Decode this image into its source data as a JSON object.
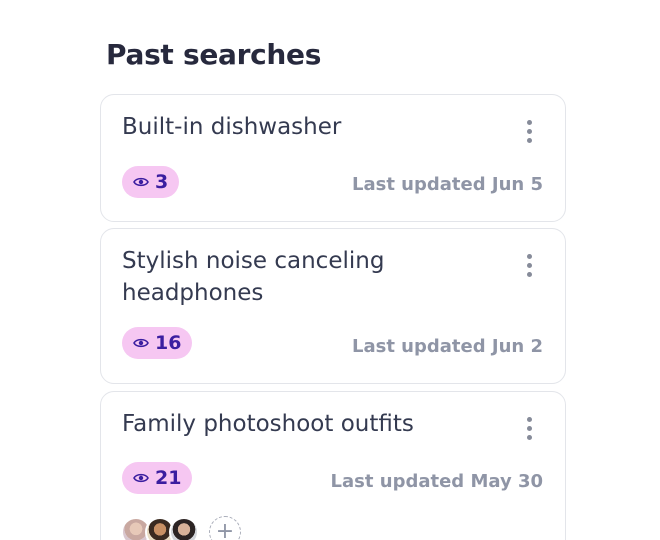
{
  "page": {
    "title": "Past searches"
  },
  "colors": {
    "badge_bg": "#f6c7f2",
    "badge_text": "#3b1ea0",
    "title_text": "#27293d",
    "muted_text": "#8f95a6",
    "card_border": "#e3e5ea"
  },
  "searches": [
    {
      "title": "Built-in dishwasher",
      "views": "3",
      "updated": "Last updated Jun 5",
      "icon": "eye-icon",
      "menu_icon": "more-vertical-icon"
    },
    {
      "title": "Stylish noise canceling headphones",
      "views": "16",
      "updated": "Last updated Jun 2",
      "icon": "eye-icon",
      "menu_icon": "more-vertical-icon"
    },
    {
      "title": "Family photoshoot outfits",
      "views": "21",
      "updated": "Last updated May 30",
      "icon": "eye-icon",
      "menu_icon": "more-vertical-icon",
      "add_icon": "plus-icon"
    }
  ]
}
